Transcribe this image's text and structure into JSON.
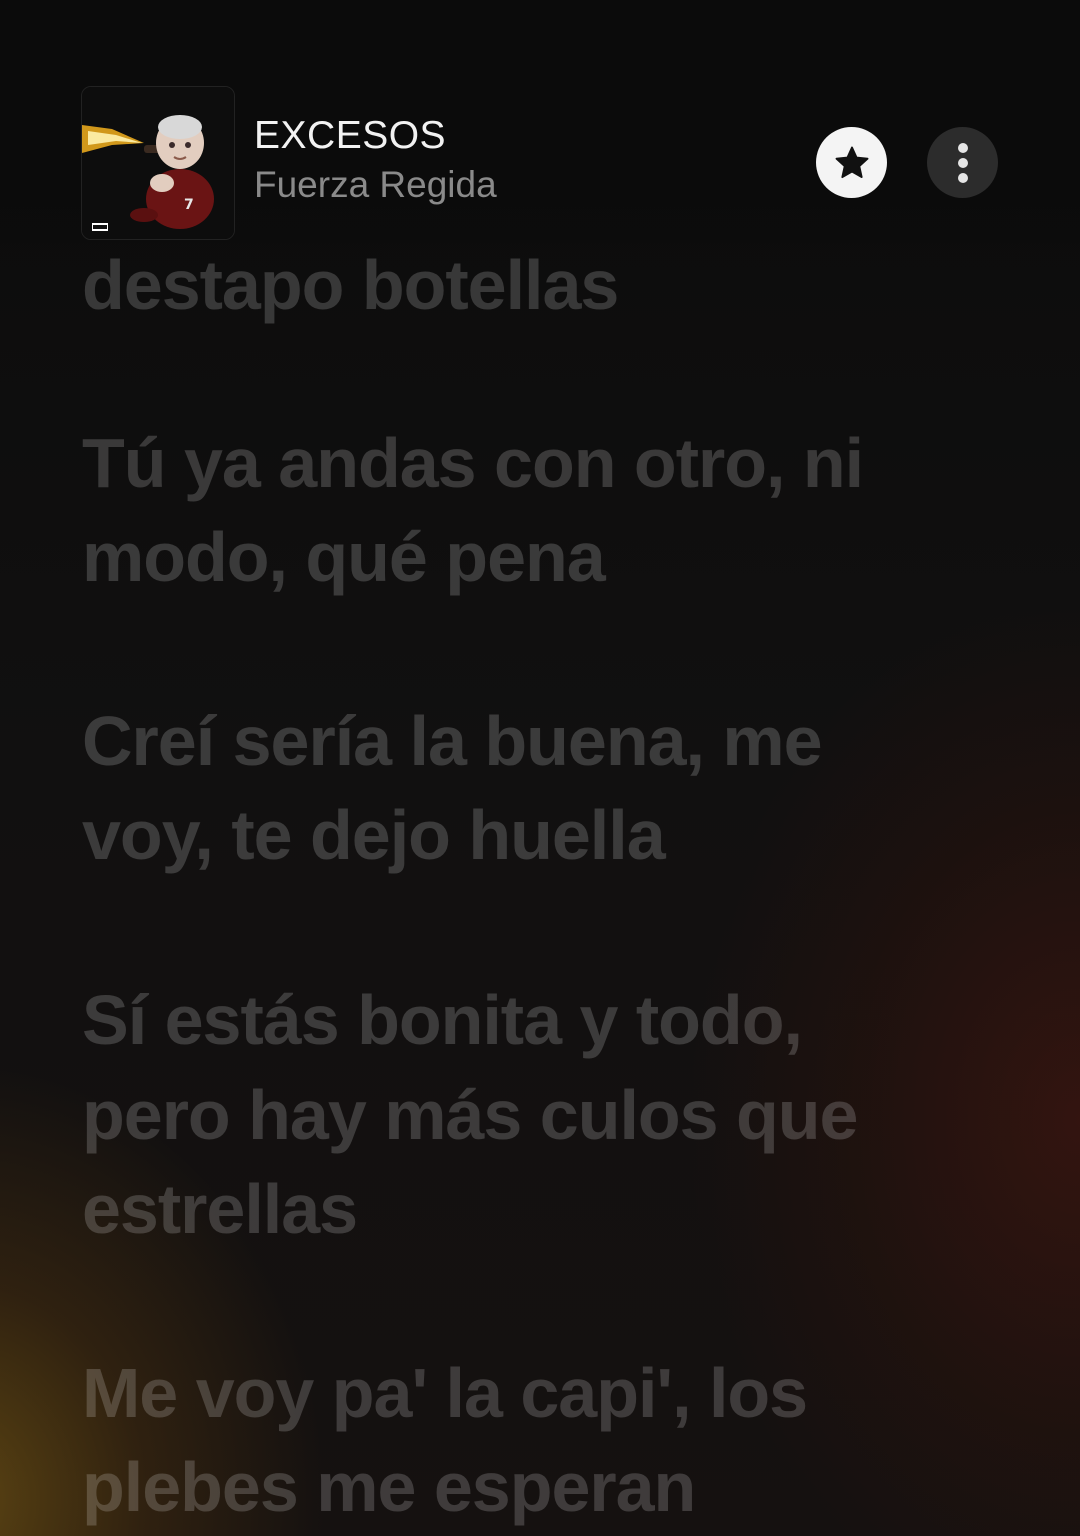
{
  "track": {
    "title": "EXCESOS",
    "artist": "Fuerza Regida",
    "artwork_icon": "album-cover"
  },
  "actions": {
    "favorite_icon": "star-icon",
    "more_icon": "more-vertical-icon"
  },
  "lyrics": [
    {
      "text": "destapo botellas"
    },
    {
      "text": "Tú ya andas con otro, ni"
    },
    {
      "text": "modo, qué pena"
    },
    {
      "text": "Creí sería la buena, me"
    },
    {
      "text": "voy, te dejo huella"
    },
    {
      "text": "Sí estás bonita y todo,"
    },
    {
      "text": "pero hay más culos que"
    },
    {
      "text": "estrellas"
    },
    {
      "text": "Me voy pa' la capi', los"
    },
    {
      "text": "plebes me esperan"
    }
  ],
  "colors": {
    "background": "#0c0c0c",
    "lyric_dim": "rgba(255,255,255,0.18)",
    "title": "#f2f2f2",
    "artist": "#8a8a8a",
    "star_button": "#f4f4f4",
    "more_button": "#2c2c2c",
    "glow_warm": "#9a6e14",
    "glow_red": "#5a1a0f"
  }
}
